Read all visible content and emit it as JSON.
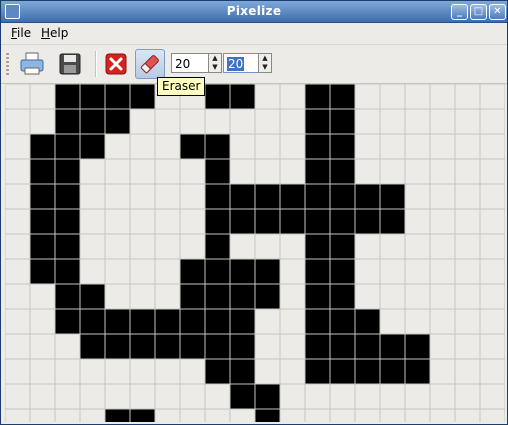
{
  "window": {
    "title": "Pixelize"
  },
  "titlebar_buttons": [
    "minimize-icon",
    "maximize-icon",
    "close-icon"
  ],
  "menu": [
    {
      "label": "File",
      "mnemonic": "F"
    },
    {
      "label": "Help",
      "mnemonic": "H"
    }
  ],
  "toolbar": {
    "buttons": [
      "print-icon",
      "save-icon",
      "clear-icon",
      "eraser-icon"
    ],
    "active_button": "eraser-icon",
    "width_value": "20",
    "height_value": "20"
  },
  "tooltip": {
    "text": "Eraser"
  },
  "canvas": {
    "columns": 20,
    "rows": 15,
    "filled_color": "#000000",
    "empty_color": "#edebe7",
    "grid_color": "#c8c5bf",
    "pixels": [
      "..####..##..##......",
      "..###.......##......",
      ".###...##...##......",
      ".##.....#...##......",
      ".##.....########....",
      ".##.....########....",
      ".##.....#...##......",
      ".##....####.##......",
      "..##...####.##......",
      "..########..###.....",
      "...#######..#####...",
      "........##..#####...",
      ".........##.........",
      "....##....#.........",
      "...##...#.........#.",
      "...#....#.....#.....",
      "...#..#####...####..",
      "...#....#.....#.....",
      "....##..#.....#....."
    ]
  }
}
